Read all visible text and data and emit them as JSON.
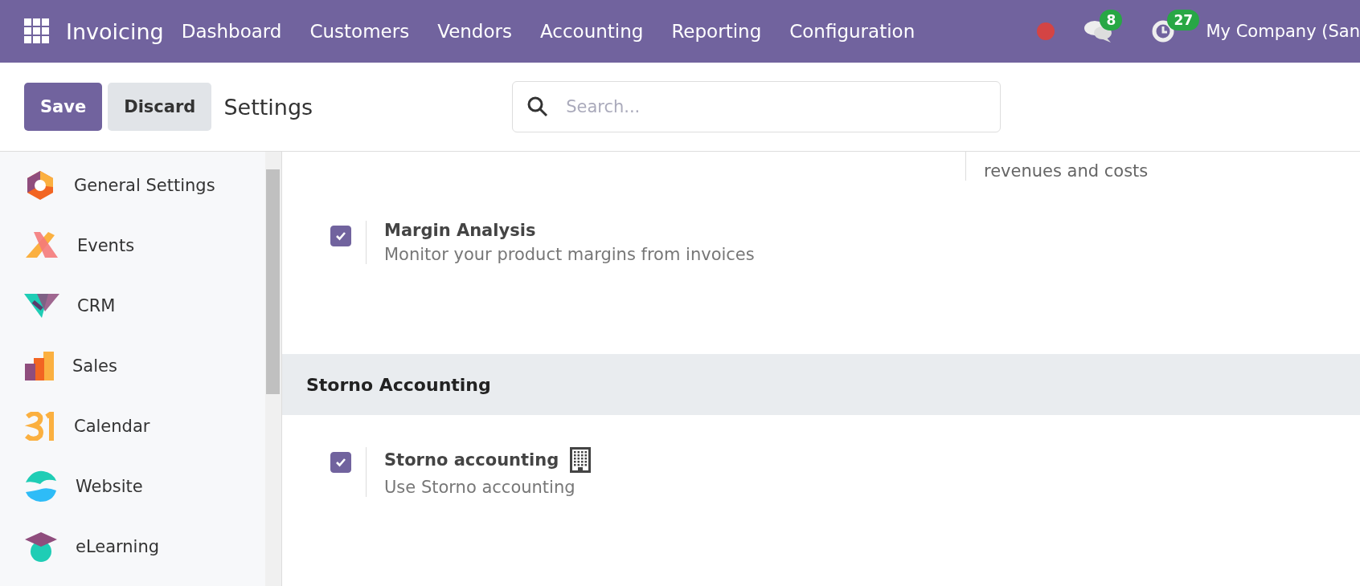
{
  "navbar": {
    "app_name": "Invoicing",
    "menus": [
      "Dashboard",
      "Customers",
      "Vendors",
      "Accounting",
      "Reporting",
      "Configuration"
    ],
    "messages_badge": "8",
    "activities_badge": "27",
    "company": "My Company (San"
  },
  "control_panel": {
    "save": "Save",
    "discard": "Discard",
    "title": "Settings",
    "search": {
      "placeholder": "Search..."
    }
  },
  "sidebar": {
    "items": [
      {
        "label": "General Settings",
        "selected": false
      },
      {
        "label": "Events",
        "selected": false
      },
      {
        "label": "CRM",
        "selected": false
      },
      {
        "label": "Sales",
        "selected": false
      },
      {
        "label": "Calendar",
        "selected": false
      },
      {
        "label": "Website",
        "selected": false
      },
      {
        "label": "eLearning",
        "selected": false
      }
    ]
  },
  "content": {
    "top_fragment": "revenues and costs",
    "sections": [
      {
        "kind": "settings",
        "settings": [
          {
            "title": "Margin Analysis",
            "description": "Monitor your product margins from invoices",
            "checked": true,
            "company_specific": false
          }
        ]
      },
      {
        "kind": "header",
        "title": "Storno Accounting"
      },
      {
        "kind": "settings",
        "settings": [
          {
            "title": "Storno accounting",
            "description": "Use Storno accounting",
            "checked": true,
            "company_specific": true
          }
        ]
      }
    ]
  }
}
